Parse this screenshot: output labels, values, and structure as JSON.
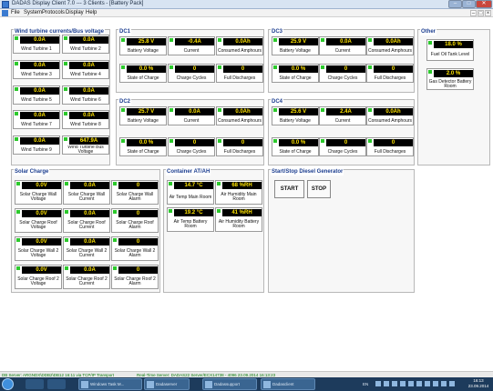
{
  "window": {
    "title": "DADAS Display Client 7.0 --- 3 Clients - [Battery Pack]",
    "minimize_glyph": "–",
    "maximize_glyph": "□",
    "close_glyph": "✕"
  },
  "menu": {
    "items": [
      "File",
      "System",
      "Protocols",
      "Display",
      "Help"
    ],
    "mdi_controls": [
      "–",
      "□",
      "×"
    ]
  },
  "wind": {
    "title": "Wind turbine currents/Bus voltage",
    "widgets": [
      {
        "value": "0.0A",
        "label": "Wind Turbine 1"
      },
      {
        "value": "0.0A",
        "label": "Wind Turbine 2"
      },
      {
        "value": "0.0A",
        "label": "Wind Turbine 3"
      },
      {
        "value": "0.0A",
        "label": "Wind Turbine 4"
      },
      {
        "value": "0.0A",
        "label": "Wind Turbine 5"
      },
      {
        "value": "0.0A",
        "label": "Wind Turbine 6"
      },
      {
        "value": "0.0A",
        "label": "Wind Turbine 7"
      },
      {
        "value": "0.0A",
        "label": "Wind Turbine 8"
      },
      {
        "value": "0.0A",
        "label": "Wind Turbine 9"
      },
      {
        "value": "647.9A",
        "label": "Wind Turbine Bus Voltage"
      }
    ]
  },
  "dc": [
    {
      "title": "DC1",
      "widgets": [
        {
          "value": "25.8 V",
          "label": "Battery Voltage"
        },
        {
          "value": "-0.4A",
          "label": "Current"
        },
        {
          "value": "0.0Ah",
          "label": "Consumed Amphours"
        },
        {
          "value": "0.0 %",
          "label": "State of Charge"
        },
        {
          "value": "0",
          "label": "Charge Cycles"
        },
        {
          "value": "0",
          "label": "Full Discharges"
        }
      ]
    },
    {
      "title": "DC2",
      "widgets": [
        {
          "value": "25.7 V",
          "label": "Battery Voltage"
        },
        {
          "value": "0.0A",
          "label": "Current"
        },
        {
          "value": "0.0Ah",
          "label": "Consumed Amphours"
        },
        {
          "value": "0.0 %",
          "label": "State of Charge"
        },
        {
          "value": "0",
          "label": "Charge Cycles"
        },
        {
          "value": "0",
          "label": "Full Discharges"
        }
      ]
    },
    {
      "title": "DC3",
      "widgets": [
        {
          "value": "25.9 V",
          "label": "Battery Voltage"
        },
        {
          "value": "0.0A",
          "label": "Current"
        },
        {
          "value": "0.0Ah",
          "label": "Consumed Amphours"
        },
        {
          "value": "0.0 %",
          "label": "State of Charge"
        },
        {
          "value": "0",
          "label": "Charge Cycles"
        },
        {
          "value": "0",
          "label": "Full Discharges"
        }
      ]
    },
    {
      "title": "DC4",
      "widgets": [
        {
          "value": "25.6 V",
          "label": "Battery Voltage"
        },
        {
          "value": "2.4A",
          "label": "Current"
        },
        {
          "value": "0.0Ah",
          "label": "Consumed Amphours"
        },
        {
          "value": "0.0 %",
          "label": "State of Charge"
        },
        {
          "value": "0",
          "label": "Charge Cycles"
        },
        {
          "value": "0",
          "label": "Full Discharges"
        }
      ]
    }
  ],
  "other": {
    "title": "Other",
    "widgets": [
      {
        "value": "18.0 %",
        "label": "Fuel Oil Tank Level"
      },
      {
        "value": "2.0 %",
        "label": "Gas Detector Battery Room"
      }
    ]
  },
  "solar": {
    "title": "Solar Charge",
    "widgets": [
      {
        "value": "0.0V",
        "label": "Solar Charge Wall Voltage"
      },
      {
        "value": "0.0A",
        "label": "Solar Charge Wall Current"
      },
      {
        "value": "0",
        "label": "Solar Charge Wall Alarm"
      },
      {
        "value": "0.0V",
        "label": "Solar Charge Roof Voltage"
      },
      {
        "value": "0.0A",
        "label": "Solar Charge Roof Current"
      },
      {
        "value": "0",
        "label": "Solar Charge Roof Alarm"
      },
      {
        "value": "0.0V",
        "label": "Solar Charge Wall 2 Voltage"
      },
      {
        "value": "0.0A",
        "label": "Solar Charge Wall 2 Current"
      },
      {
        "value": "0",
        "label": "Solar Charge Wall 2 Alarm"
      },
      {
        "value": "0.0V",
        "label": "Solar Charge Roof 2 Voltage"
      },
      {
        "value": "0.0A",
        "label": "Solar Charge Roof 2 Current"
      },
      {
        "value": "0",
        "label": "Solar Charge Roof 2 Alarm"
      }
    ]
  },
  "container": {
    "title": "Container AT/AH",
    "widgets": [
      {
        "value": "14.7 °C",
        "label": "Air Temp Main Room"
      },
      {
        "value": "68 %RH",
        "label": "Air Humidity Main Room"
      },
      {
        "value": "19.2 °C",
        "label": "Air Temp Battery Room"
      },
      {
        "value": "41 %RH",
        "label": "Air Humidity Battery Room"
      }
    ]
  },
  "diesel": {
    "title": "Start/Stop Diesel Generator",
    "start_label": "START",
    "stop_label": "STOP"
  },
  "status": {
    "left": "DB Server: ARGNDX\\DDB2\\DB12 16:11 via TCP/IP Transport",
    "right": "Real-Time Server: DADAS22 Server/ECX14738 - 4096    23.09.2014 16:13:23"
  },
  "taskbar": {
    "tasks": [
      "Windows Task M...",
      "Dadaserver",
      "Dadassupport",
      "Dadasclient"
    ],
    "tray_lang": "EN",
    "clock_time": "16:13",
    "clock_date": "23.09.2014"
  },
  "colors": {
    "panel_title": "#1b3d8f",
    "display_bg": "#000000",
    "display_text": "#ffe400",
    "led_on": "#2cc92c",
    "status_text": "#0a7a0a"
  }
}
